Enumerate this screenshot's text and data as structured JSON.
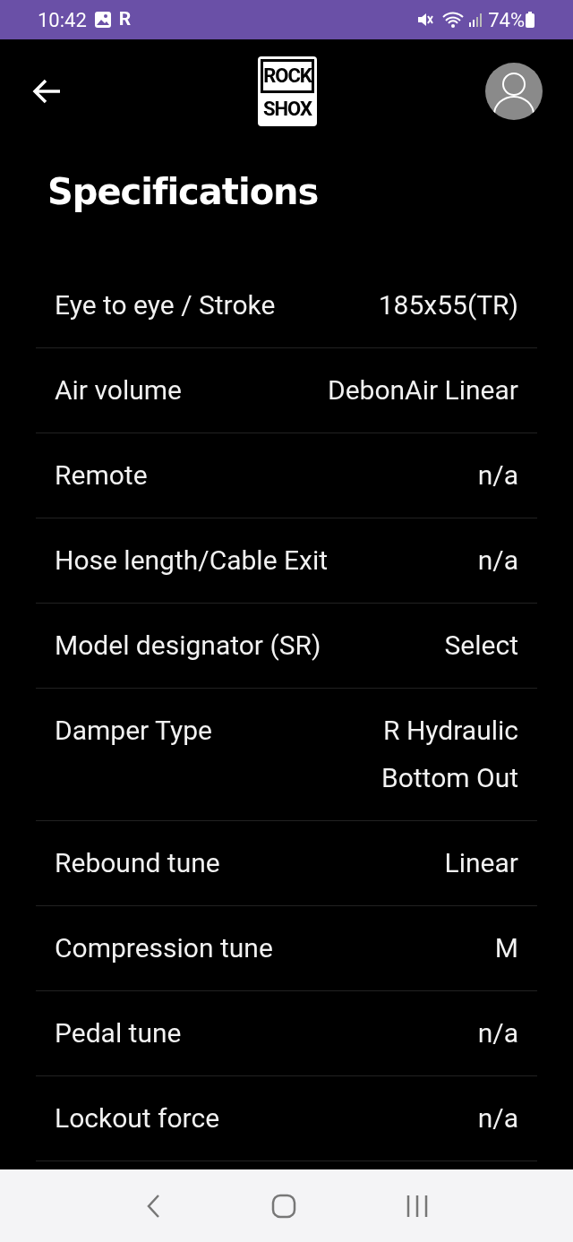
{
  "status_bar": {
    "time": "10:42",
    "app_letter": "R",
    "battery": "74%"
  },
  "header": {
    "logo": [
      "ROCK",
      "SHOX"
    ]
  },
  "title": "Specifications",
  "specs": [
    {
      "label": "Eye to eye / Stroke",
      "value": [
        "185x55(TR)"
      ]
    },
    {
      "label": "Air volume",
      "value": [
        "DebonAir Linear"
      ]
    },
    {
      "label": "Remote",
      "value": [
        "n/a"
      ]
    },
    {
      "label": "Hose length/Cable Exit",
      "value": [
        "n/a"
      ]
    },
    {
      "label": "Model designator (SR)",
      "value": [
        "Select"
      ]
    },
    {
      "label": "Damper Type",
      "value": [
        "R Hydraulic",
        "Bottom Out"
      ]
    },
    {
      "label": "Rebound tune",
      "value": [
        "Linear"
      ]
    },
    {
      "label": "Compression tune",
      "value": [
        "M"
      ]
    },
    {
      "label": "Pedal tune",
      "value": [
        "n/a"
      ]
    },
    {
      "label": "Lockout force",
      "value": [
        "n/a"
      ]
    }
  ]
}
